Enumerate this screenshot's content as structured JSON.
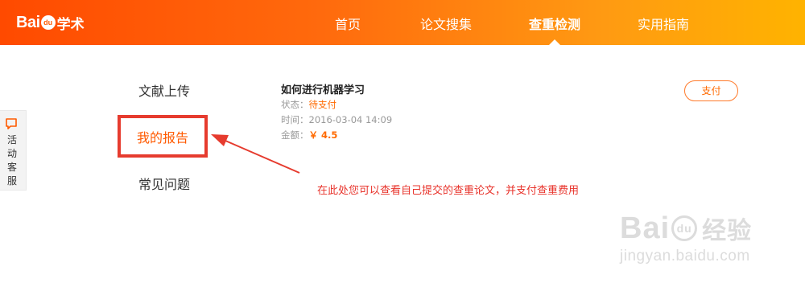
{
  "header": {
    "logo_bai": "Bai",
    "logo_du": "du",
    "logo_xueshu": "学术",
    "nav": [
      {
        "label": "首页"
      },
      {
        "label": "论文搜集"
      },
      {
        "label": "查重检测",
        "active": true
      },
      {
        "label": "实用指南"
      }
    ]
  },
  "service_tab": {
    "icon": "chat-bubble-icon",
    "label": "活动客服"
  },
  "sidebar": {
    "items": [
      {
        "label": "文献上传"
      },
      {
        "label": "我的报告",
        "active": true
      },
      {
        "label": "常见问题"
      }
    ]
  },
  "report": {
    "title": "如何进行机器学习",
    "status_label": "状态：",
    "status_value": "待支付",
    "time_label": "时间：",
    "time_value": "2016-03-04 14:09",
    "amount_label": "金额：",
    "amount_value": "￥ 4.5",
    "pay_label": "支付"
  },
  "annotation": "在此处您可以查看自己提交的查重论文，并支付查重费用",
  "watermark": {
    "logo_bai": "Bai",
    "logo_du": "du",
    "logo_cn": "经验",
    "url": "jingyan.baidu.com"
  },
  "colors": {
    "accent": "#ff5a00",
    "highlight": "#e63b2e",
    "annotation": "#e8332b"
  }
}
